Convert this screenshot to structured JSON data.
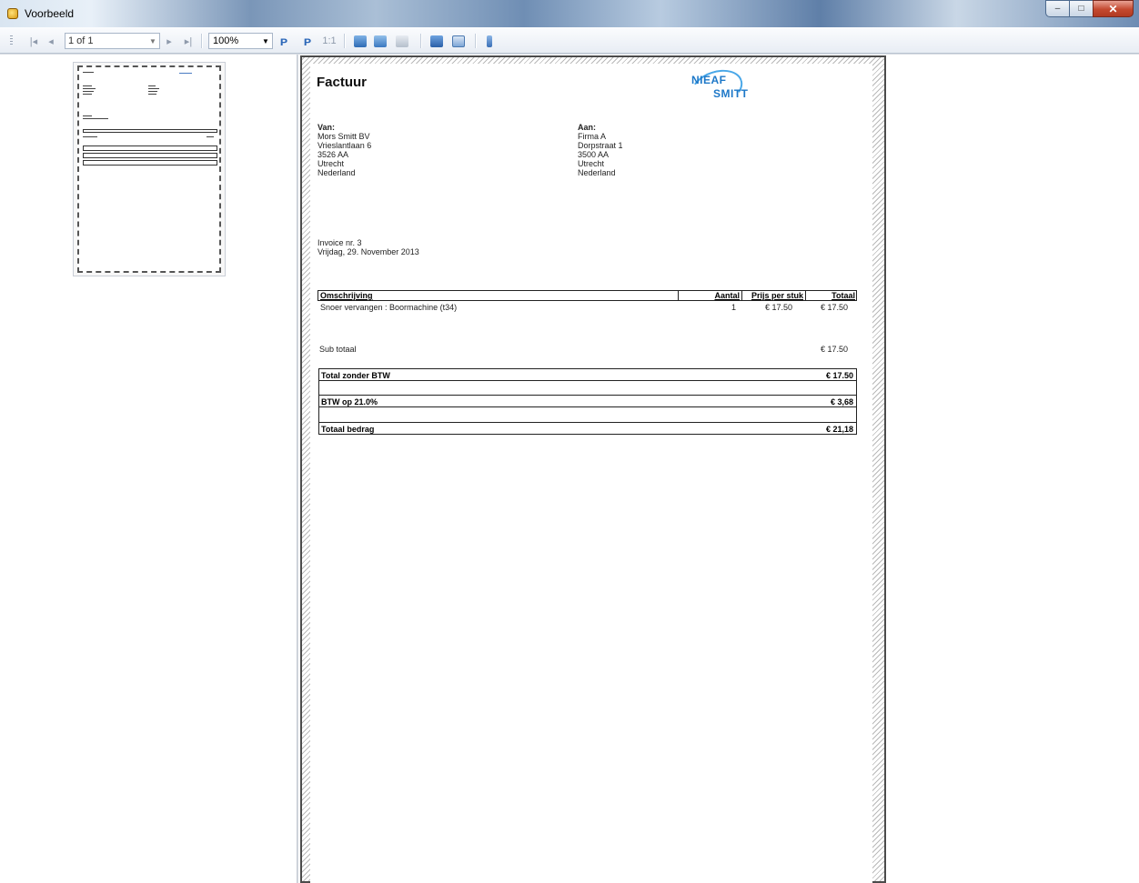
{
  "window": {
    "title": "Voorbeeld",
    "minimize": "–",
    "maximize": "□",
    "close": "✕"
  },
  "toolbar": {
    "page_indicator": "1 of 1",
    "zoom": "100%",
    "icons": [
      "first-page-icon",
      "previous-page-icon",
      "next-page-icon",
      "last-page-icon",
      "zoom-in-icon",
      "zoom-out-icon",
      "actual-size-icon",
      "print-icon",
      "quick-print-icon",
      "page-setup-icon",
      "save-icon",
      "export-icon",
      "close-preview-icon"
    ]
  },
  "invoice": {
    "title": "Factuur",
    "logo": {
      "line1": "NIEAF",
      "line2": "SMITT"
    },
    "from": {
      "label": "Van:",
      "lines": [
        "Mors Smitt BV",
        "Vrieslantlaan 6",
        "3526 AA",
        "Utrecht",
        "Nederland"
      ]
    },
    "to": {
      "label": "Aan:",
      "lines": [
        "Firma A",
        "Dorpstraat 1",
        "3500 AA",
        "Utrecht",
        "Nederland"
      ]
    },
    "invoice_number": "Invoice nr. 3",
    "date": "Vrijdag, 29. November 2013",
    "table": {
      "headers": {
        "description": "Omschrijving",
        "quantity": "Aantal",
        "unit_price": "Prijs per stuk",
        "total": "Totaal"
      },
      "rows": [
        {
          "description": "Snoer vervangen :  Boormachine  (t34)",
          "quantity": "1",
          "unit_price": "€ 17.50",
          "total": "€ 17.50"
        }
      ]
    },
    "subtotal": {
      "label": "Sub totaal",
      "value": "€ 17.50"
    },
    "totals": [
      {
        "label": "Total zonder BTW",
        "value": "€ 17.50"
      },
      {
        "label": "BTW op 21.0%",
        "value": "€ 3,68"
      },
      {
        "label": "Totaal bedrag",
        "value": "€ 21,18"
      }
    ]
  }
}
